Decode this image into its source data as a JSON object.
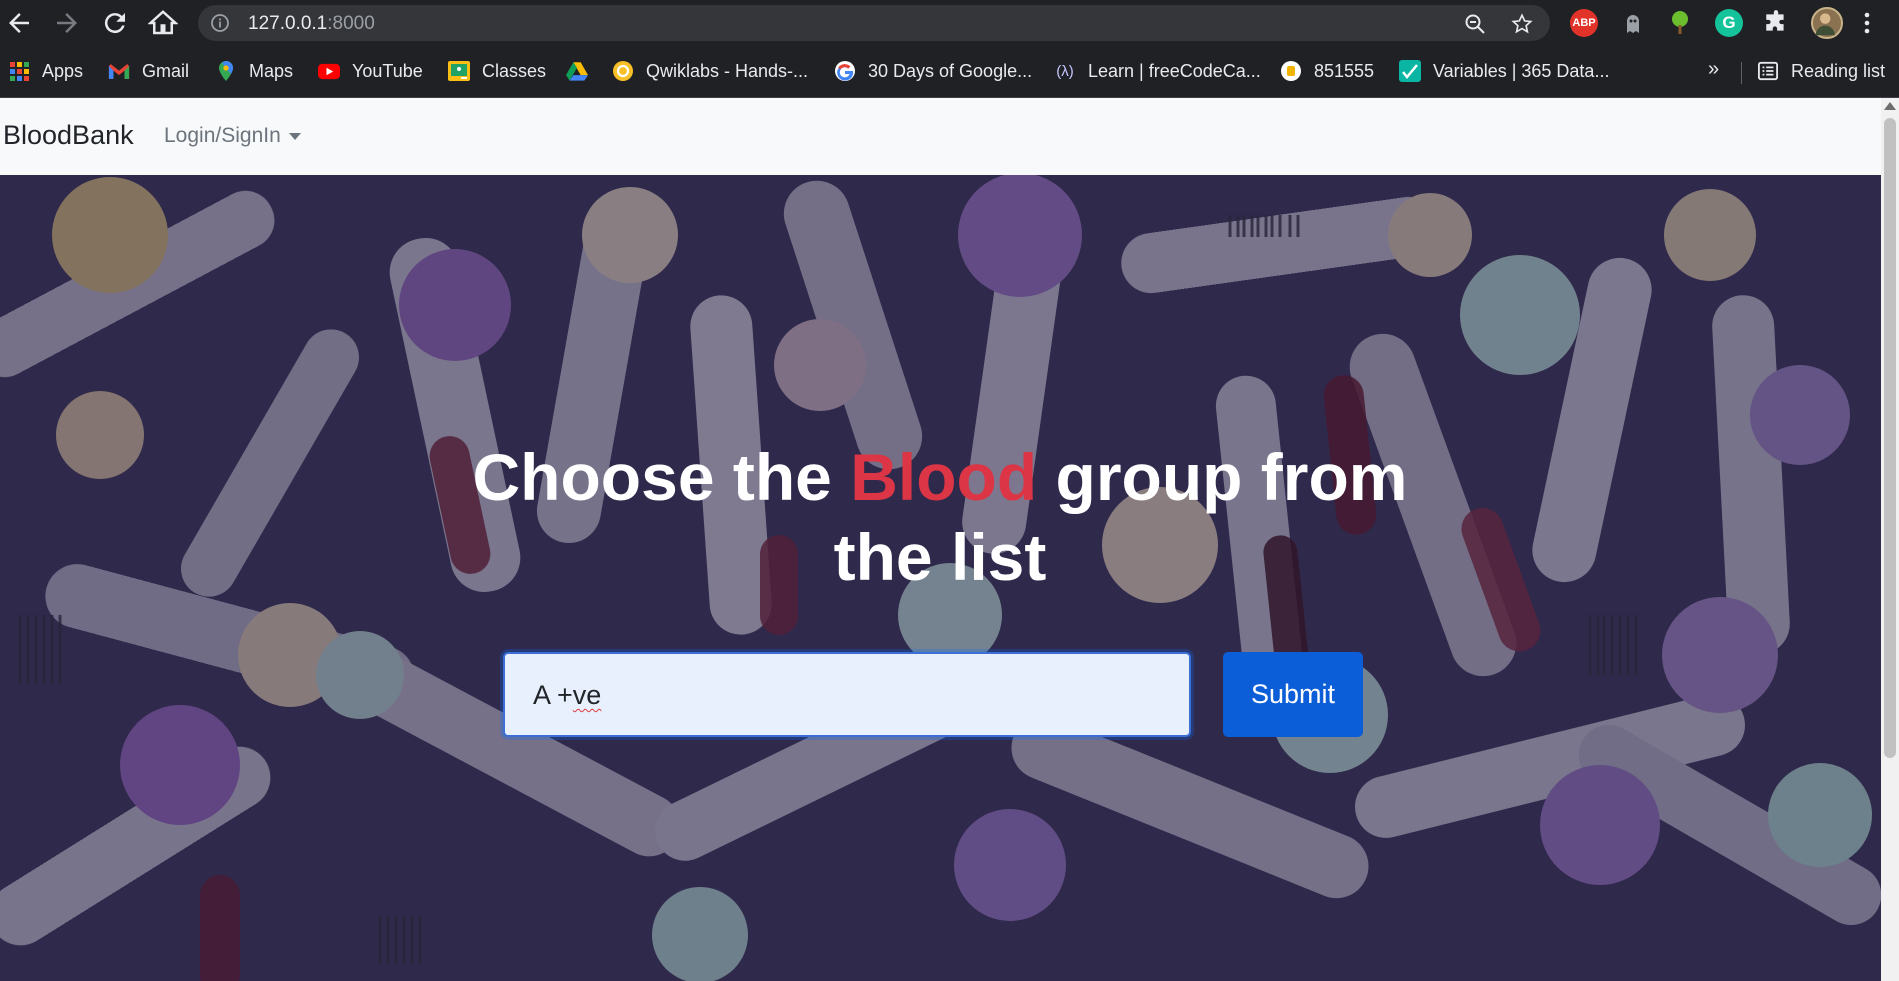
{
  "browser": {
    "url_host": "127.0.0.1",
    "url_port": ":8000",
    "bookmarks": [
      {
        "label": "Apps",
        "icon": "apps-grid-icon"
      },
      {
        "label": "Gmail",
        "icon": "gmail-icon"
      },
      {
        "label": "Maps",
        "icon": "maps-icon"
      },
      {
        "label": "YouTube",
        "icon": "youtube-icon"
      },
      {
        "label": "Classes",
        "icon": "classroom-icon"
      },
      {
        "label": "",
        "icon": "google-drive-icon"
      },
      {
        "label": "Qwiklabs - Hands-...",
        "icon": "qwiklabs-icon"
      },
      {
        "label": "30 Days of Google...",
        "icon": "google-icon"
      },
      {
        "label": "Learn | freeCodeCa...",
        "icon": "freecodecamp-icon"
      },
      {
        "label": "851555",
        "icon": "bookmark-851555-icon"
      },
      {
        "label": "Variables | 365 Data...",
        "icon": "365-data-icon"
      }
    ],
    "overflow": "»",
    "reading_list": "Reading list",
    "extensions": [
      "abp-icon",
      "ghost-extension-icon",
      "tree-extension-icon",
      "grammarly-icon",
      "extensions-puzzle-icon",
      "profile-avatar"
    ],
    "abp_label": "ABP",
    "grammarly_label": "G",
    "colors": {
      "chrome_bg": "#202124",
      "omnibox_bg": "#35363a"
    }
  },
  "page": {
    "brand": "BloodBank",
    "menu": "Login/SignIn",
    "headline": {
      "pre": "Choose the ",
      "highlight": "Blood",
      "post": " group from the list"
    },
    "input_value": {
      "prefix": "A +",
      "flagged": "ve"
    },
    "submit": "Submit",
    "colors": {
      "highlight": "#dc3545",
      "button": "#0b5ed7",
      "input_bg": "#e8f0fe"
    }
  }
}
